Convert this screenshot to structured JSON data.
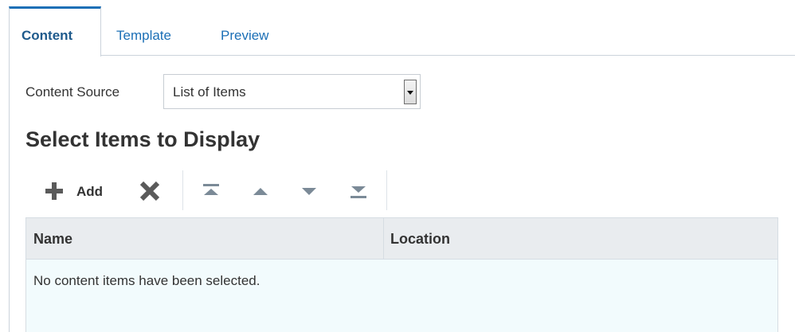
{
  "tabs": [
    {
      "label": "Content",
      "active": true
    },
    {
      "label": "Template",
      "active": false
    },
    {
      "label": "Preview",
      "active": false
    }
  ],
  "content_source": {
    "label": "Content Source",
    "value": "List of Items"
  },
  "section_title": "Select Items to Display",
  "toolbar": {
    "add_label": "Add",
    "icons": [
      "plus-icon",
      "delete-x-icon",
      "move-to-top-icon",
      "move-up-icon",
      "move-down-icon",
      "move-to-bottom-icon"
    ]
  },
  "table": {
    "columns": [
      "Name",
      "Location"
    ],
    "empty_message": "No content items have been selected."
  },
  "colors": {
    "accent": "#1b6fb6",
    "active_tab_text": "#1e5a8c",
    "icon_gray": "#5a5a5a",
    "icon_light": "#7b8a97",
    "table_body_bg": "#f2fbfd",
    "table_header_bg": "#e9ecef"
  }
}
